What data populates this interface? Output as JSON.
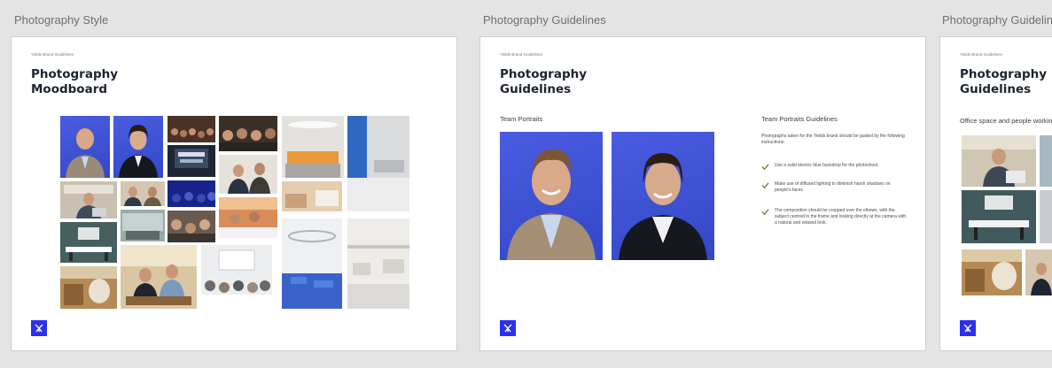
{
  "canvas": {
    "frames": [
      {
        "label": "Photography Style",
        "doc_tag": "Yields Brand Guidelines",
        "title": "Photography Moodboard",
        "logo_icon": "yields-logo-icon",
        "photos": [
          "portrait-man-blue-backdrop",
          "portrait-woman-blue-backdrop",
          "conference-audience",
          "presentation-audience",
          "modern-lounge-interior",
          "office-lobby-blue-wall",
          "event-stage-screen",
          "business-meeting",
          "man-with-laptop",
          "team-meeting",
          "office-interior",
          "office-workspace",
          "event-crowd-blue",
          "office-cubicles",
          "conference-room",
          "people-at-event",
          "office-corridor",
          "seminar-audience",
          "colleagues-with-laptops",
          "woodwork-sign",
          "blue-carpet-office",
          "open-plan-office"
        ]
      },
      {
        "label": "Photography Guidelines",
        "doc_tag": "Yields Brand Guidelines",
        "title": "Photography Guidelines",
        "section_left": "Team Portraits",
        "section_right": "Team Portraits Guidelines",
        "intro": "Photographs taken for the Yields brand should be guided by the following instructions:",
        "rules": [
          "Use a solid electric blue backdrop for the photoshoot.",
          "Make use of diffused lighting to diminish harsh shadows on people's faces.",
          "The composition should be cropped over the elbows, with the subject centred in the frame and looking directly at the camera with a natural and relaxed look."
        ],
        "logo_icon": "yields-logo-icon"
      },
      {
        "label": "Photography Guidelines",
        "doc_tag": "Yields Brand Guidelines",
        "title": "Photography Guidelines",
        "section_left": "Office space and people working",
        "logo_icon": "yields-logo-icon"
      }
    ]
  },
  "colors": {
    "accent": "#2b30f0",
    "backdrop_blue": "#3a4fd6",
    "canvas_bg": "#e4e4e4",
    "check": "#4a7a2a"
  }
}
